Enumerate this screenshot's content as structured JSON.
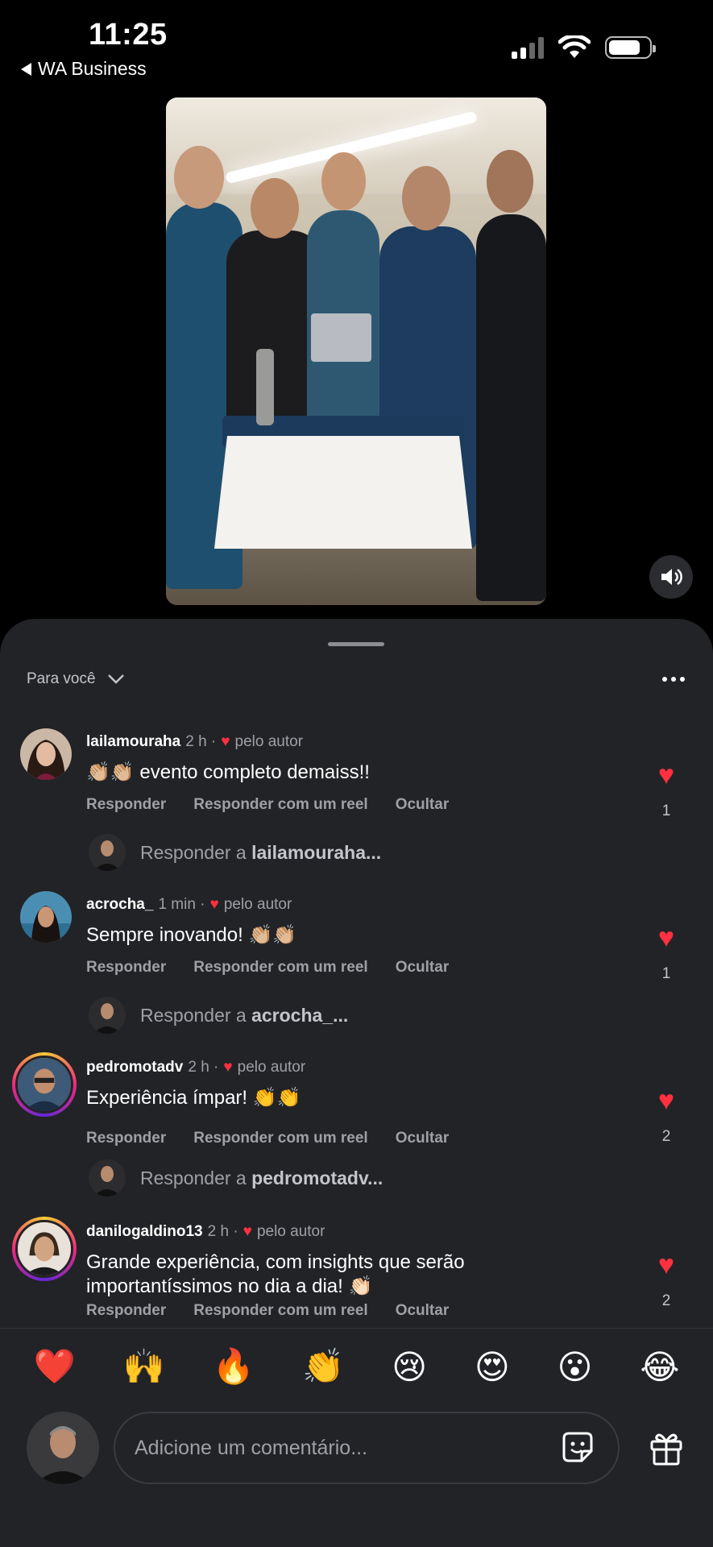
{
  "status_bar": {
    "time": "11:25",
    "back_app": "WA Business"
  },
  "video": {
    "volume_icon": "speaker-icon"
  },
  "sheet": {
    "filter_label": "Para você"
  },
  "comments": [
    {
      "username": "lailamouraha",
      "time": "2 h ·",
      "liked_by_author": "pelo autor",
      "text": "👏🏼👏🏼 evento completo demaiss!!",
      "likes": "1",
      "reply_prefix": "Responder a",
      "reply_target": "lailamouraha..."
    },
    {
      "username": "acrocha_",
      "time": "1 min ·",
      "liked_by_author": "pelo autor",
      "text": "Sempre inovando! 👏🏼👏🏼",
      "likes": "1",
      "reply_prefix": "Responder a",
      "reply_target": "acrocha_..."
    },
    {
      "username": "pedromotadv",
      "time": "2 h ·",
      "liked_by_author": "pelo autor",
      "text": "Experiência ímpar! 👏👏",
      "likes": "2",
      "reply_prefix": "Responder a",
      "reply_target": "pedromotadv..."
    },
    {
      "username": "danilogaldino13",
      "time": "2 h ·",
      "liked_by_author": "pelo autor",
      "text": "Grande experiência, com insights que serão importantíssimos no dia a dia! 👏🏻",
      "likes": "2"
    }
  ],
  "actions": {
    "reply": "Responder",
    "reply_reel": "Responder com um reel",
    "hide": "Ocultar"
  },
  "emoji_bar": [
    "❤️",
    "🙌",
    "🔥",
    "👏",
    "😢",
    "😍",
    "😮",
    "😂"
  ],
  "composer": {
    "placeholder": "Adicione um comentário..."
  },
  "colors": {
    "sheet_bg": "#222327",
    "like_red": "#ff3040",
    "muted_text": "#9fa0a5"
  }
}
